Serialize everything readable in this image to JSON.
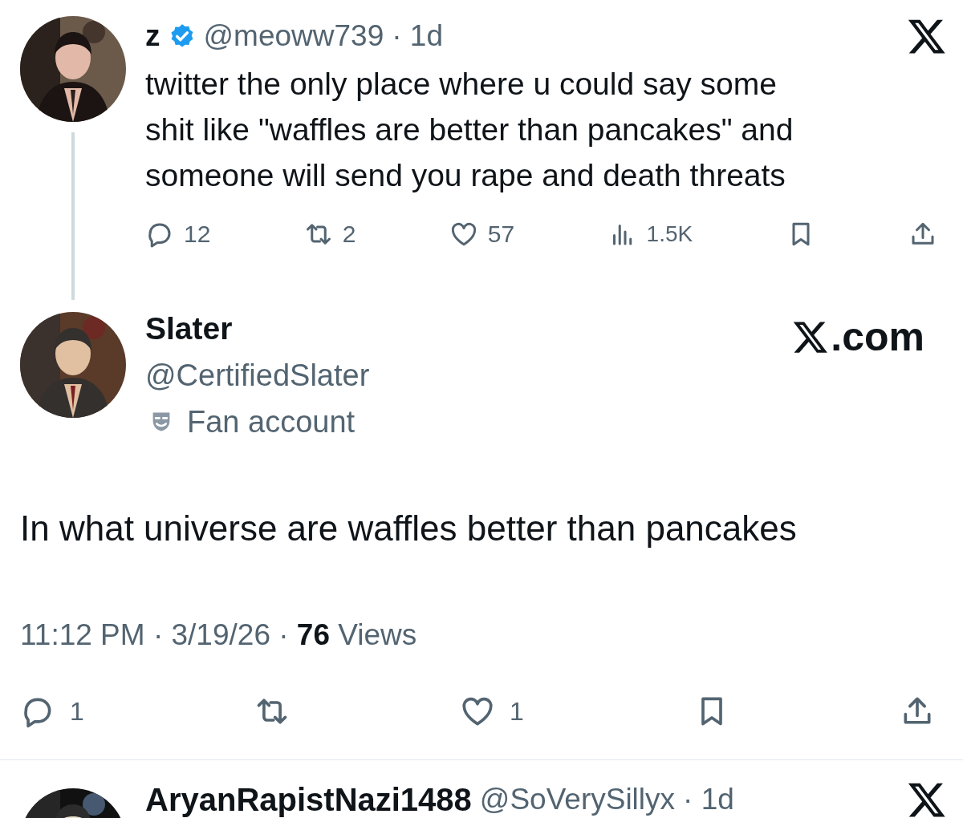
{
  "tweets": [
    {
      "kind": "thread_parent",
      "author": {
        "name": "z",
        "verified": true,
        "handle": "@meoww739"
      },
      "time": "· 1d",
      "text": "twitter the only place where u could say some shit like \"waffles are better than pancakes\" and someone will send you rape and death threats",
      "actions": [
        {
          "kind": "reply",
          "count": "12"
        },
        {
          "kind": "repost",
          "count": "2"
        },
        {
          "kind": "like",
          "count": "57"
        },
        {
          "kind": "views",
          "count": "1.5K"
        },
        {
          "kind": "bookmark"
        },
        {
          "kind": "share"
        }
      ]
    },
    {
      "kind": "focused",
      "author": {
        "name": "Slater",
        "verified": false,
        "handle": "@CertifiedSlater",
        "label": "Fan account"
      },
      "source": ".com",
      "text": "In what universe are waffles better than pancakes",
      "meta": "11:12 PM · 3/19/26 · **76** Views",
      "actions": [
        {
          "kind": "reply",
          "count": "1"
        },
        {
          "kind": "repost"
        },
        {
          "kind": "like",
          "count": "1"
        },
        {
          "kind": "bookmark"
        },
        {
          "kind": "share"
        }
      ]
    },
    {
      "kind": "reply_preview",
      "author": {
        "name": "AryanRapistNazi1488",
        "verified": false,
        "handle": "@SoVerySillyx"
      },
      "time": "· 1d"
    }
  ]
}
